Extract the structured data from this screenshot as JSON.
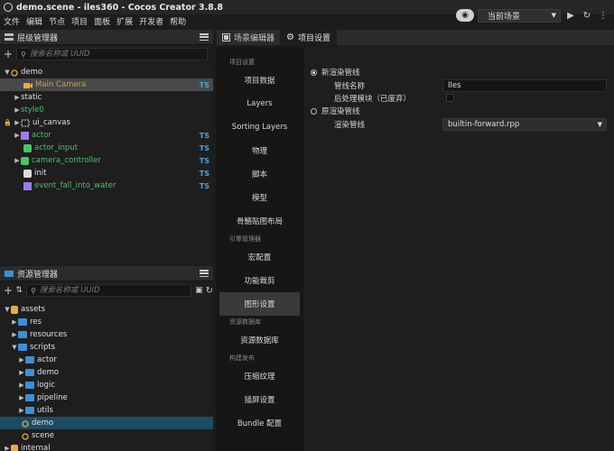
{
  "window": {
    "title": "demo.scene - iles360 - Cocos Creator 3.8.8"
  },
  "menu": [
    "文件",
    "编辑",
    "节点",
    "项目",
    "面板",
    "扩展",
    "开发者",
    "帮助"
  ],
  "toolbar": {
    "scene_select": "当前场景"
  },
  "hierarchy": {
    "title": "层级管理器",
    "search_placeholder": "搜索名称或 UUID",
    "nodes": [
      {
        "label": "demo"
      },
      {
        "label": "Main Camera",
        "badge": "TS"
      },
      {
        "label": "static"
      },
      {
        "label": "style0"
      },
      {
        "label": "ui_canvas"
      },
      {
        "label": "actor",
        "badge": "TS"
      },
      {
        "label": "actor_input",
        "badge": "TS"
      },
      {
        "label": "camera_controller",
        "badge": "TS"
      },
      {
        "label": "init",
        "badge": "TS"
      },
      {
        "label": "event_fall_into_water",
        "badge": "TS"
      }
    ]
  },
  "assets": {
    "title": "资源管理器",
    "search_placeholder": "搜索名称或 UUID",
    "nodes": [
      {
        "label": "assets"
      },
      {
        "label": "res"
      },
      {
        "label": "resources"
      },
      {
        "label": "scripts"
      },
      {
        "label": "actor"
      },
      {
        "label": "demo"
      },
      {
        "label": "logic"
      },
      {
        "label": "pipeline"
      },
      {
        "label": "utils"
      },
      {
        "label": "demo"
      },
      {
        "label": "scene"
      },
      {
        "label": "internal"
      }
    ]
  },
  "tabs": [
    {
      "label": "场景编辑器"
    },
    {
      "label": "项目设置"
    }
  ],
  "settings_nav": {
    "sections": {
      "project": "项目设置",
      "engine": "引擎管理器",
      "database": "资源数据库",
      "build": "构建发布"
    },
    "items": {
      "project_data": "项目数据",
      "layers": "Layers",
      "sorting_layers": "Sorting Layers",
      "physics": "物理",
      "script": "脚本",
      "model": "模型",
      "skeleton_atlas": "骨骼贴图布局",
      "macro": "宏配置",
      "feature_crop": "功能裁剪",
      "graphics": "图形设置",
      "asset_db": "资源数据库",
      "texture_compress": "压缩纹理",
      "splash": "插屏设置",
      "bundle": "Bundle 配置"
    }
  },
  "settings_content": {
    "new_pipeline": "新渲染管线",
    "pipeline_name_label": "管线名称",
    "pipeline_name_value": "Iles",
    "post_process_label": "后处理模块（已废弃）",
    "legacy_pipeline": "原渲染管线",
    "render_pipeline_label": "渲染管线",
    "render_pipeline_value": "builtin-forward.rpp"
  }
}
